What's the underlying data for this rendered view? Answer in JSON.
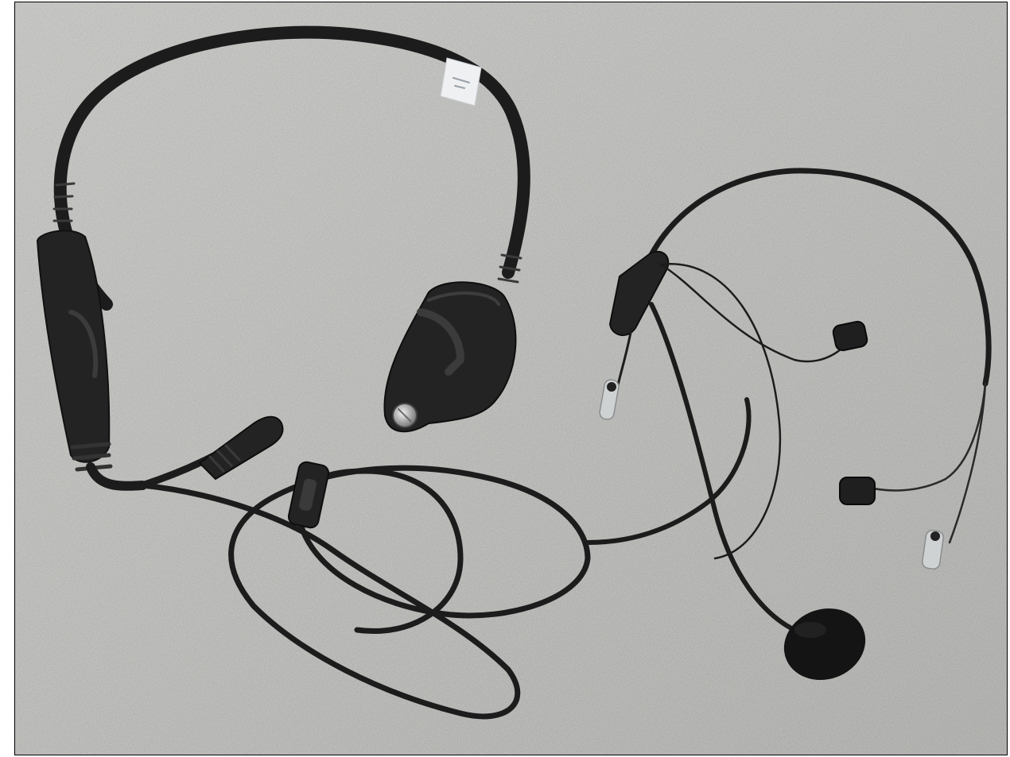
{
  "photo": {
    "subject": "headset-with-ptt-cable",
    "colors": {
      "surface": "#b8b8b5",
      "surface_speckle_light": "#d6d6d3",
      "surface_speckle_dark": "#8f8f8c",
      "cable": "#1c1c1c",
      "plastic": "#232323",
      "metal": "#c9c9c9",
      "foam": "#141414",
      "label": "#eef0f2"
    }
  }
}
